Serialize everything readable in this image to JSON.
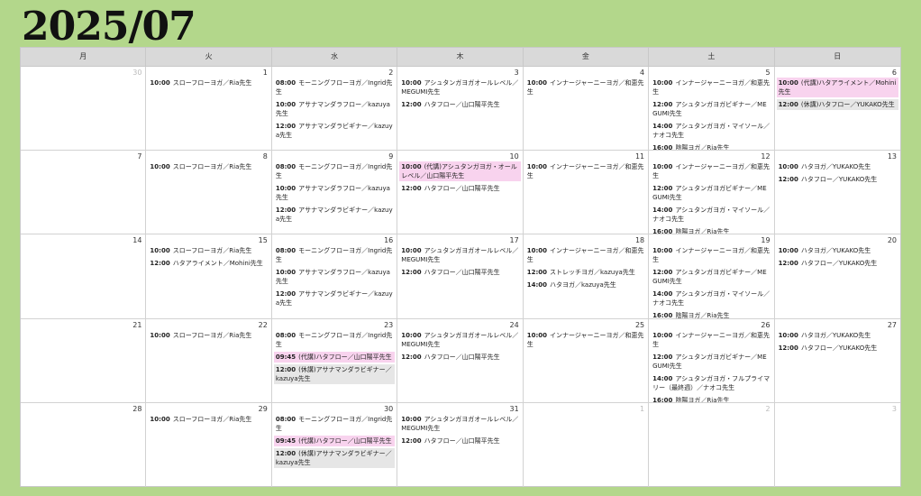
{
  "title": "2025/07",
  "weekdays": [
    "月",
    "火",
    "水",
    "木",
    "金",
    "土",
    "日"
  ],
  "days": [
    {
      "d": "30",
      "dim": true,
      "events": []
    },
    {
      "d": "1",
      "events": [
        {
          "t": "10:00",
          "x": "スローフローヨガ／Ria先生"
        }
      ]
    },
    {
      "d": "2",
      "events": [
        {
          "t": "08:00",
          "x": "モーニングフローヨガ／Ingrid先生"
        },
        {
          "t": "10:00",
          "x": "アサナマンダラフロー／kazuya先生"
        },
        {
          "t": "12:00",
          "x": "アサナマンダラビギナー／kazuya先生"
        }
      ]
    },
    {
      "d": "3",
      "events": [
        {
          "t": "10:00",
          "x": "アシュタンガヨガオールレベル／MEGUMI先生"
        },
        {
          "t": "12:00",
          "x": "ハタフロー／山口陽平先生"
        }
      ]
    },
    {
      "d": "4",
      "events": [
        {
          "t": "10:00",
          "x": "インナージャーニーヨガ／和恵先生"
        }
      ]
    },
    {
      "d": "5",
      "events": [
        {
          "t": "10:00",
          "x": "インナージャーニーヨガ／和恵先生"
        },
        {
          "t": "12:00",
          "x": "アシュタンガヨガビギナー／MEGUMI先生"
        },
        {
          "t": "14:00",
          "x": "アシュタンガヨガ・マイソール／ナオコ先生"
        },
        {
          "t": "16:00",
          "x": "陰陽ヨガ／Ria先生"
        }
      ]
    },
    {
      "d": "6",
      "events": [
        {
          "t": "10:00",
          "x": "(代講)ハタアライメント／Mohini先生",
          "k": "sub"
        },
        {
          "t": "12:00",
          "x": "(休講)ハタフロー／YUKAKO先生",
          "k": "off"
        }
      ]
    },
    {
      "d": "7",
      "events": []
    },
    {
      "d": "8",
      "events": [
        {
          "t": "10:00",
          "x": "スローフローヨガ／Ria先生"
        }
      ]
    },
    {
      "d": "9",
      "events": [
        {
          "t": "08:00",
          "x": "モーニングフローヨガ／Ingrid先生"
        },
        {
          "t": "10:00",
          "x": "アサナマンダラフロー／kazuya先生"
        },
        {
          "t": "12:00",
          "x": "アサナマンダラビギナー／kazuya先生"
        }
      ]
    },
    {
      "d": "10",
      "events": [
        {
          "t": "10:00",
          "x": "(代講)アシュタンガヨガ・オールレベル／山口陽平先生",
          "k": "sub"
        },
        {
          "t": "12:00",
          "x": "ハタフロー／山口陽平先生"
        }
      ]
    },
    {
      "d": "11",
      "events": [
        {
          "t": "10:00",
          "x": "インナージャーニーヨガ／和恵先生"
        }
      ]
    },
    {
      "d": "12",
      "events": [
        {
          "t": "10:00",
          "x": "インナージャーニーヨガ／和恵先生"
        },
        {
          "t": "12:00",
          "x": "アシュタンガヨガビギナー／MEGUMI先生"
        },
        {
          "t": "14:00",
          "x": "アシュタンガヨガ・マイソール／ナオコ先生"
        },
        {
          "t": "16:00",
          "x": "陰陽ヨガ／Ria先生"
        }
      ]
    },
    {
      "d": "13",
      "events": [
        {
          "t": "10:00",
          "x": "ハタヨガ／YUKAKO先生"
        },
        {
          "t": "12:00",
          "x": "ハタフロー／YUKAKO先生"
        }
      ]
    },
    {
      "d": "14",
      "events": []
    },
    {
      "d": "15",
      "events": [
        {
          "t": "10:00",
          "x": "スローフローヨガ／Ria先生"
        },
        {
          "t": "12:00",
          "x": "ハタアライメント／Mohini先生"
        }
      ]
    },
    {
      "d": "16",
      "events": [
        {
          "t": "08:00",
          "x": "モーニングフローヨガ／Ingrid先生"
        },
        {
          "t": "10:00",
          "x": "アサナマンダラフロー／kazuya先生"
        },
        {
          "t": "12:00",
          "x": "アサナマンダラビギナー／kazuya先生"
        }
      ]
    },
    {
      "d": "17",
      "events": [
        {
          "t": "10:00",
          "x": "アシュタンガヨガオールレベル／MEGUMI先生"
        },
        {
          "t": "12:00",
          "x": "ハタフロー／山口陽平先生"
        }
      ]
    },
    {
      "d": "18",
      "events": [
        {
          "t": "10:00",
          "x": "インナージャーニーヨガ／和恵先生"
        },
        {
          "t": "12:00",
          "x": "ストレッチヨガ／kazuya先生"
        },
        {
          "t": "14:00",
          "x": "ハタヨガ／kazuya先生"
        }
      ]
    },
    {
      "d": "19",
      "events": [
        {
          "t": "10:00",
          "x": "インナージャーニーヨガ／和恵先生"
        },
        {
          "t": "12:00",
          "x": "アシュタンガヨガビギナー／MEGUMI先生"
        },
        {
          "t": "14:00",
          "x": "アシュタンガヨガ・マイソール／ナオコ先生"
        },
        {
          "t": "16:00",
          "x": "陰陽ヨガ／Ria先生"
        }
      ]
    },
    {
      "d": "20",
      "events": [
        {
          "t": "10:00",
          "x": "ハタヨガ／YUKAKO先生"
        },
        {
          "t": "12:00",
          "x": "ハタフロー／YUKAKO先生"
        }
      ]
    },
    {
      "d": "21",
      "events": []
    },
    {
      "d": "22",
      "events": [
        {
          "t": "10:00",
          "x": "スローフローヨガ／Ria先生"
        }
      ]
    },
    {
      "d": "23",
      "events": [
        {
          "t": "08:00",
          "x": "モーニングフローヨガ／Ingrid先生"
        },
        {
          "t": "09:45",
          "x": "(代講)ハタフロー／山口陽平先生",
          "k": "sub"
        },
        {
          "t": "12:00",
          "x": "(休講)アサナマンダラビギナー／kazuya先生",
          "k": "off"
        }
      ]
    },
    {
      "d": "24",
      "events": [
        {
          "t": "10:00",
          "x": "アシュタンガヨガオールレベル／MEGUMI先生"
        },
        {
          "t": "12:00",
          "x": "ハタフロー／山口陽平先生"
        }
      ]
    },
    {
      "d": "25",
      "events": [
        {
          "t": "10:00",
          "x": "インナージャーニーヨガ／和恵先生"
        }
      ]
    },
    {
      "d": "26",
      "events": [
        {
          "t": "10:00",
          "x": "インナージャーニーヨガ／和恵先生"
        },
        {
          "t": "12:00",
          "x": "アシュタンガヨガビギナー／MEGUMI先生"
        },
        {
          "t": "14:00",
          "x": "アシュタンガヨガ・フルプライマリー（最終週）／ナオコ先生"
        },
        {
          "t": "16:00",
          "x": "陰陽ヨガ／Ria先生"
        }
      ]
    },
    {
      "d": "27",
      "events": [
        {
          "t": "10:00",
          "x": "ハタヨガ／YUKAKO先生"
        },
        {
          "t": "12:00",
          "x": "ハタフロー／YUKAKO先生"
        }
      ]
    },
    {
      "d": "28",
      "events": []
    },
    {
      "d": "29",
      "events": [
        {
          "t": "10:00",
          "x": "スローフローヨガ／Ria先生"
        }
      ]
    },
    {
      "d": "30",
      "events": [
        {
          "t": "08:00",
          "x": "モーニングフローヨガ／Ingrid先生"
        },
        {
          "t": "09:45",
          "x": "(代講)ハタフロー／山口陽平先生",
          "k": "sub"
        },
        {
          "t": "12:00",
          "x": "(休講)アサナマンダラビギナー／kazuya先生",
          "k": "off"
        }
      ]
    },
    {
      "d": "31",
      "events": [
        {
          "t": "10:00",
          "x": "アシュタンガヨガオールレベル／MEGUMI先生"
        },
        {
          "t": "12:00",
          "x": "ハタフロー／山口陽平先生"
        }
      ]
    },
    {
      "d": "1",
      "dim": true,
      "events": []
    },
    {
      "d": "2",
      "dim": true,
      "events": []
    },
    {
      "d": "3",
      "dim": true,
      "events": []
    }
  ]
}
